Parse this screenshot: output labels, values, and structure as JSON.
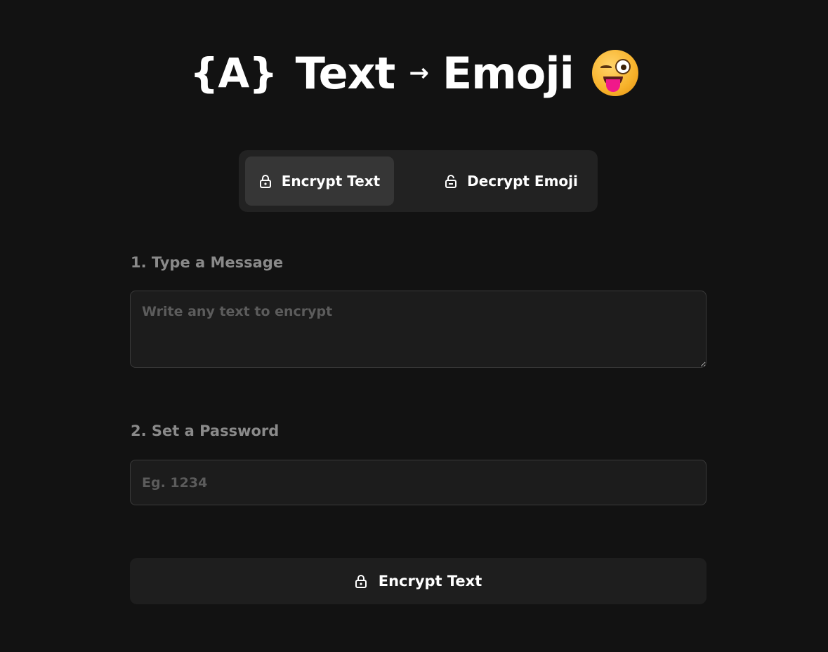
{
  "header": {
    "braces": "{A}",
    "word_text": "Text",
    "arrow": "→",
    "word_emoji": "Emoji",
    "emoji_icon": "winking-face-with-tongue-emoji"
  },
  "tabs": [
    {
      "label": "Encrypt Text",
      "icon": "lock-icon",
      "active": true
    },
    {
      "label": "Decrypt Emoji",
      "icon": "unlock-icon",
      "active": false
    }
  ],
  "form": {
    "message_label": "1. Type a Message",
    "message_placeholder": "Write any text to encrypt",
    "message_value": "",
    "password_label": "2. Set a Password",
    "password_placeholder": "Eg. 1234",
    "password_value": "",
    "submit_label": "Encrypt Text",
    "submit_icon": "lock-icon"
  },
  "colors": {
    "background": "#121212",
    "panel": "#222222",
    "active_tab": "#363636",
    "input_bg": "#1c1c1c",
    "label": "#8a8a8a"
  }
}
